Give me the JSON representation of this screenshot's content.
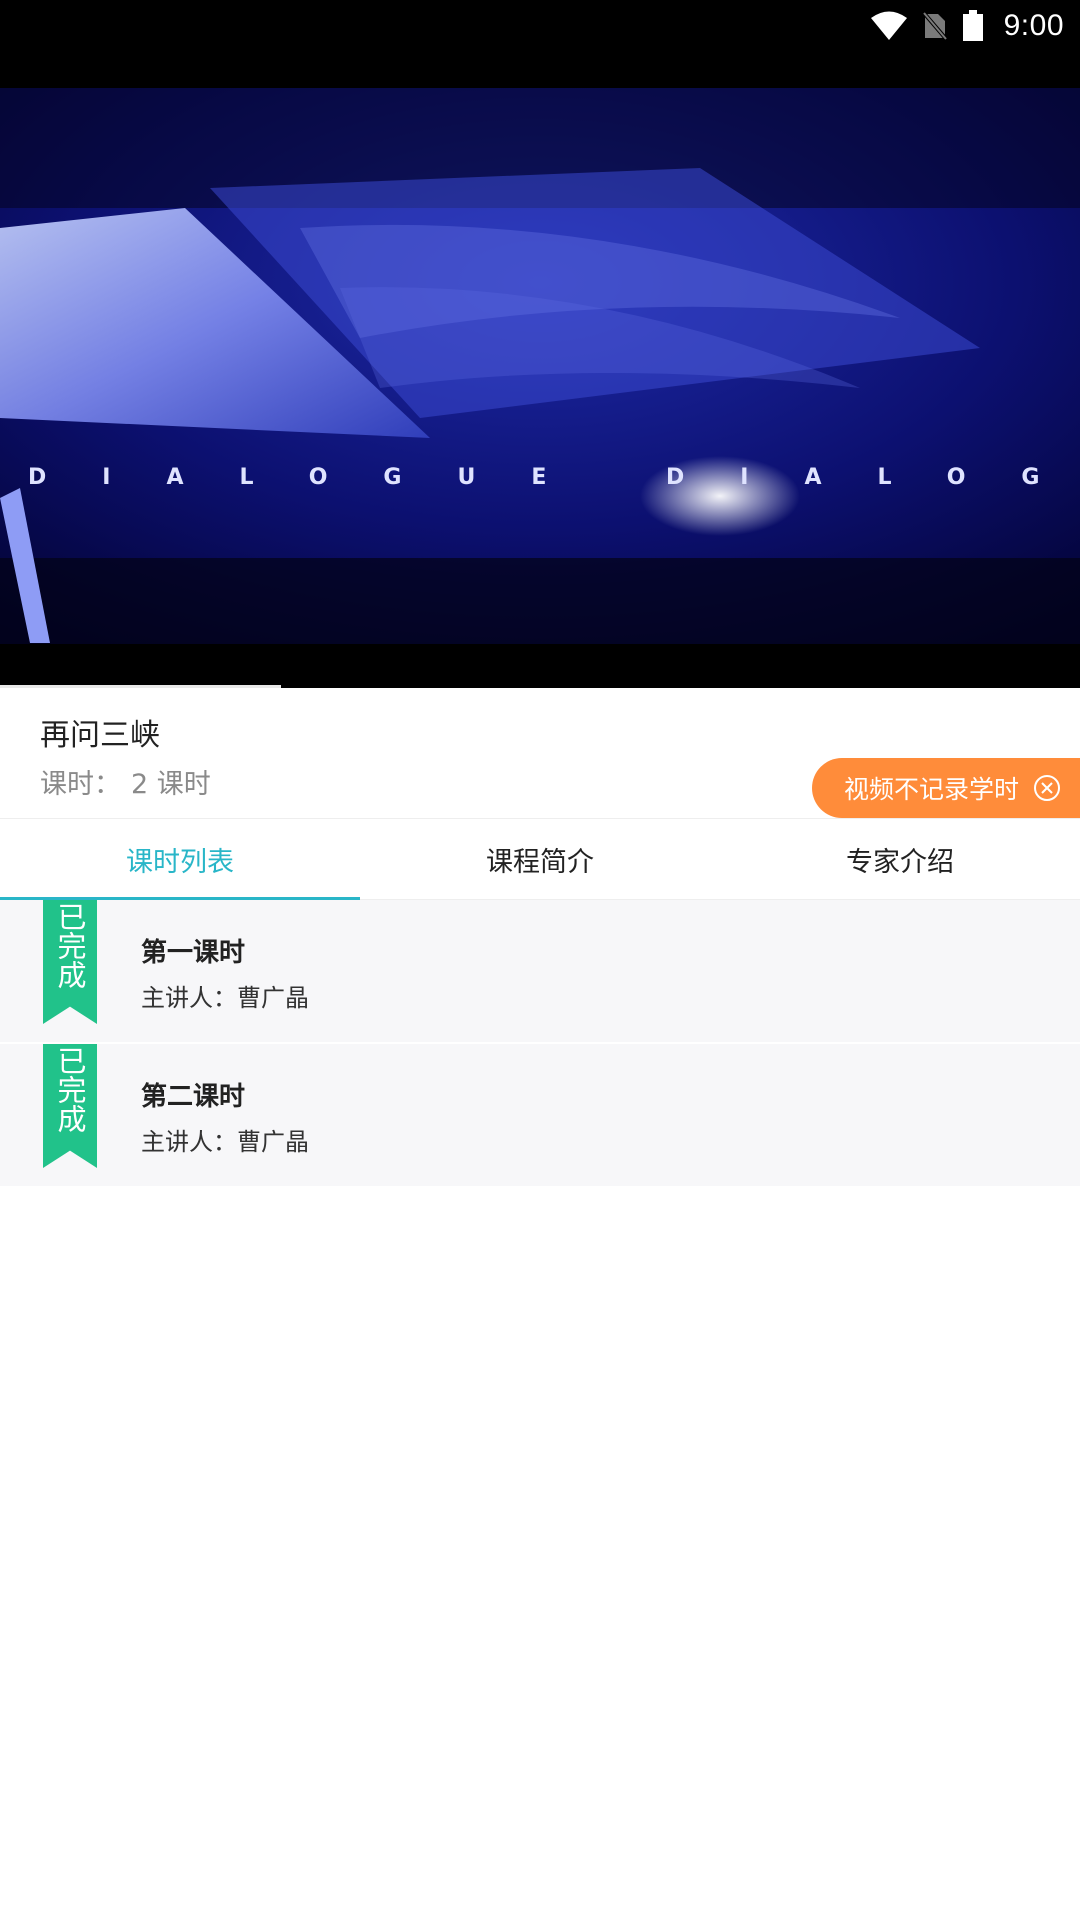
{
  "status_bar": {
    "time": "9:00",
    "icons": [
      "wifi-icon",
      "no-sim-icon",
      "battery-icon"
    ]
  },
  "video": {
    "overlay_text": "DIALOGUE DIALOG",
    "progress": 0.26
  },
  "course": {
    "title": "再问三峡",
    "hours_label": "课时：",
    "hours_value": "2 课时"
  },
  "badge": {
    "label": "视频不记录学时",
    "icon": "close-circle-icon",
    "color": "#ff8c3a"
  },
  "tabs": [
    {
      "label": "课时列表",
      "active": true
    },
    {
      "label": "课程简介",
      "active": false
    },
    {
      "label": "专家介绍",
      "active": false
    }
  ],
  "lessons": [
    {
      "status": "已完成",
      "title": "第一课时",
      "speaker": "主讲人：曹广晶"
    },
    {
      "status": "已完成",
      "title": "第二课时",
      "speaker": "主讲人：曹广晶"
    }
  ],
  "colors": {
    "accent": "#29b6c8",
    "completed": "#21c28a",
    "badge": "#ff8c3a"
  }
}
